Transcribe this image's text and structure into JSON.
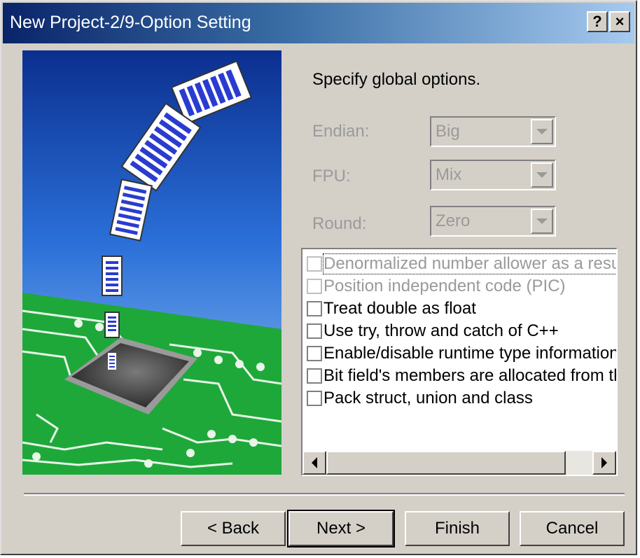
{
  "window": {
    "title": "New Project-2/9-Option Setting",
    "help_label": "?",
    "close_label": "×"
  },
  "instruction": "Specify global options.",
  "fields": {
    "endian": {
      "label": "Endian:",
      "value": "Big"
    },
    "fpu": {
      "label": "FPU:",
      "value": "Mix"
    },
    "round": {
      "label": "Round:",
      "value": "Zero"
    }
  },
  "options": [
    {
      "label": "Denormalized number allower as a result",
      "checked": false,
      "enabled": false
    },
    {
      "label": "Position independent code (PIC)",
      "checked": false,
      "enabled": false
    },
    {
      "label": "Treat double as float",
      "checked": false,
      "enabled": true
    },
    {
      "label": "Use try, throw and catch of C++",
      "checked": false,
      "enabled": true
    },
    {
      "label": "Enable/disable runtime type information",
      "checked": false,
      "enabled": true
    },
    {
      "label": "Bit field's members are allocated from the low",
      "checked": false,
      "enabled": true
    },
    {
      "label": "Pack struct, union and class",
      "checked": false,
      "enabled": true
    }
  ],
  "buttons": {
    "back": "< Back",
    "next": "Next >",
    "finish": "Finish",
    "cancel": "Cancel"
  },
  "colors": {
    "title_start": "#0a246a",
    "title_end": "#a6caf0",
    "face": "#d4d0c8",
    "sky": "#2a6fd8",
    "board": "#1fa83a",
    "disabled_text": "#9a9a9a"
  }
}
